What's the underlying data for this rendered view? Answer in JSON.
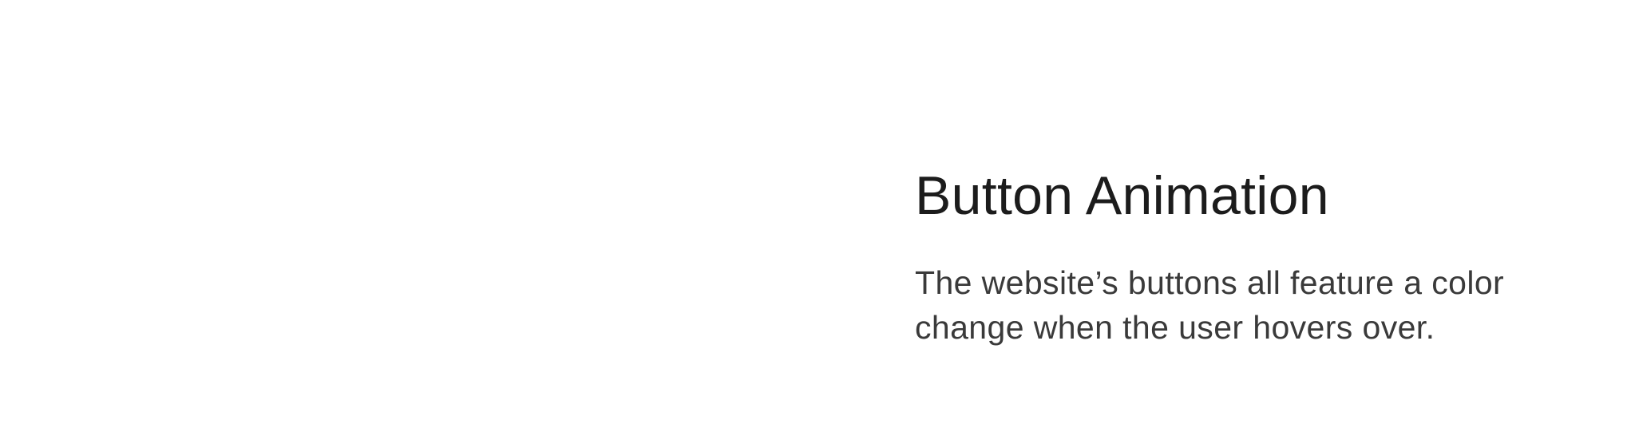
{
  "section": {
    "title": "Button Animation",
    "description": "The website’s buttons all feature a color change when the user hovers over."
  },
  "colors": {
    "background": "#ffffff",
    "title_text": "#1c1c1c",
    "body_text": "#3a3a3a"
  }
}
